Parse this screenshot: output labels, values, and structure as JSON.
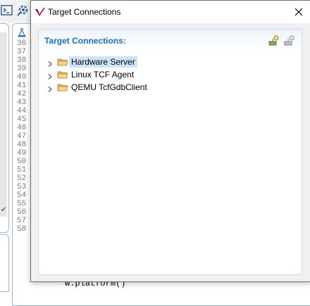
{
  "background": {
    "line_numbers": [
      "36",
      "37",
      "38",
      "39",
      "40",
      "41",
      "42",
      "43",
      "44",
      "45",
      "46",
      "47",
      "48",
      "49",
      "50",
      "51",
      "52",
      "53",
      "54",
      "55",
      "56",
      "57",
      "58"
    ],
    "code_text": "w.platform()"
  },
  "dialog": {
    "title": "Target Connections",
    "panel_title": "Target Connections:",
    "tree": [
      {
        "label": "Hardware Server",
        "selected": true
      },
      {
        "label": "Linux TCF Agent",
        "selected": false
      },
      {
        "label": "QEMU TcfGdbClient",
        "selected": false
      }
    ]
  },
  "icons": {
    "app": "xilinx-logo-icon",
    "close": "close-icon",
    "add": "add-connection-icon",
    "remove": "remove-connection-icon",
    "folder": "folder-icon",
    "chevron": "chevron-right-icon"
  },
  "colors": {
    "panel_title": "#1c6fb8",
    "selection": "#cce4f7",
    "folder": "#f2c46b",
    "logo": "#c8102e"
  }
}
